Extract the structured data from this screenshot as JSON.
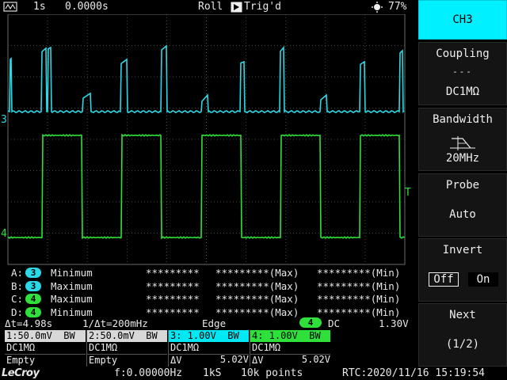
{
  "status": {
    "timebase": "1s",
    "position": "0.0000s",
    "mode": "Roll",
    "trig_state": "Trig'd",
    "battery": "77%"
  },
  "markers": {
    "ch3": "3",
    "ch4": "4",
    "trigger": "T"
  },
  "measurements": [
    {
      "label": "A:",
      "ch": "3",
      "name": "Minimum",
      "v1": "*********",
      "v2": "*********(Max)",
      "v3": "*********(Min)"
    },
    {
      "label": "B:",
      "ch": "3",
      "name": "Maximum",
      "v1": "*********",
      "v2": "*********(Max)",
      "v3": "*********(Min)"
    },
    {
      "label": "C:",
      "ch": "4",
      "name": "Maximum",
      "v1": "*********",
      "v2": "*********(Max)",
      "v3": "*********(Min)"
    },
    {
      "label": "D:",
      "ch": "4",
      "name": "Minimum",
      "v1": "*********",
      "v2": "*********(Max)",
      "v3": "*********(Min)"
    }
  ],
  "cursor": {
    "dt": "Δt=4.98s",
    "inv_dt": "1/Δt=200mHz"
  },
  "trigger": {
    "type": "Edge",
    "source": "4",
    "coupling": "DC",
    "level": "1.30V"
  },
  "channels": [
    {
      "head": "1:50.0mV  BW",
      "coupling": "DC1MΩ",
      "foot": "Empty",
      "dv": ""
    },
    {
      "head": "2:50.0mV  BW",
      "coupling": "DC1MΩ",
      "foot": "Empty",
      "dv": ""
    },
    {
      "head": "3: 1.00V  BW",
      "coupling": "DC1MΩ",
      "foot": "ΔV",
      "dv": "5.02V"
    },
    {
      "head": "4: 1.00V  BW",
      "coupling": "DC1MΩ",
      "foot": "ΔV",
      "dv": "5.02V"
    }
  ],
  "footer": {
    "brand": "LeCroy",
    "freq": "f:0.00000Hz",
    "sample": "1kS",
    "points": "10k points",
    "rtc": "RTC:2020/11/16 15:19:54"
  },
  "menu": {
    "header": "CH3",
    "coupling": {
      "title": "Coupling",
      "symbol": "---",
      "value": "DC1MΩ"
    },
    "bandwidth": {
      "title": "Bandwidth",
      "value": "20MHz"
    },
    "probe": {
      "title": "Probe",
      "value": "Auto"
    },
    "invert": {
      "title": "Invert",
      "off": "Off",
      "on": "On"
    },
    "next": {
      "title": "Next",
      "value": "(1/2)"
    }
  },
  "colors": {
    "ch3": "#2bd8e6",
    "ch4": "#2fe03a",
    "menu_header": "#00f0ff",
    "grid": "#5a5a5a"
  },
  "waveforms": {
    "ch3_pulse_cycles": [
      {
        "start": 0.52,
        "rise_top": 1.25,
        "fall": 1.75,
        "width": 0.14
      },
      {
        "start": 4.3,
        "rise_top": 0.4,
        "fall": 0.4,
        "width": 0.09
      },
      {
        "start": 7.9,
        "rise_top": 1.25,
        "fall": 1.75,
        "width": 0.14
      }
    ]
  }
}
